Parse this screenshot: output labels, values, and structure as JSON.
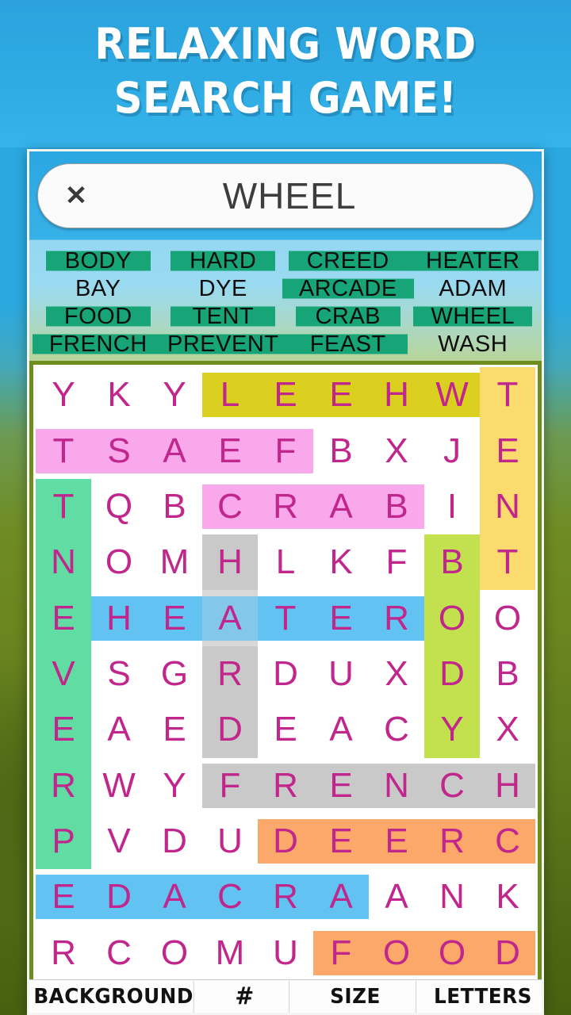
{
  "hero": {
    "line1": "RELAXING WORD",
    "line2": "SEARCH GAME!"
  },
  "search": {
    "value": "WHEEL",
    "clear_icon": "close-icon",
    "clear_glyph": "✕"
  },
  "wordlist": {
    "words": [
      {
        "text": "BODY",
        "found": true
      },
      {
        "text": "HARD",
        "found": true
      },
      {
        "text": "CREED",
        "found": true
      },
      {
        "text": "HEATER",
        "found": true
      },
      {
        "text": "BAY",
        "found": false
      },
      {
        "text": "DYE",
        "found": false
      },
      {
        "text": "ARCADE",
        "found": true
      },
      {
        "text": "ADAM",
        "found": false
      },
      {
        "text": "FOOD",
        "found": true
      },
      {
        "text": "TENT",
        "found": true
      },
      {
        "text": "CRAB",
        "found": true
      },
      {
        "text": "WHEEL",
        "found": true
      },
      {
        "text": "FRENCH",
        "found": true
      },
      {
        "text": "PREVENT",
        "found": true
      },
      {
        "text": "FEAST",
        "found": true
      },
      {
        "text": "WASH",
        "found": false
      }
    ],
    "found_bar_color": "#17a578",
    "panel_color": "#9adaf0"
  },
  "grid": {
    "rows": 11,
    "cols": 9,
    "letter_color": "#c0268c",
    "letters": [
      [
        "Y",
        "K",
        "Y",
        "L",
        "E",
        "E",
        "H",
        "W",
        "T"
      ],
      [
        "T",
        "S",
        "A",
        "E",
        "F",
        "B",
        "X",
        "J",
        "E"
      ],
      [
        "T",
        "Q",
        "B",
        "C",
        "R",
        "A",
        "B",
        "I",
        "N"
      ],
      [
        "N",
        "O",
        "M",
        "H",
        "L",
        "K",
        "F",
        "B",
        "T"
      ],
      [
        "E",
        "H",
        "E",
        "A",
        "T",
        "E",
        "R",
        "O",
        "O"
      ],
      [
        "V",
        "S",
        "G",
        "R",
        "D",
        "U",
        "X",
        "D",
        "B"
      ],
      [
        "E",
        "A",
        "E",
        "D",
        "E",
        "A",
        "C",
        "Y",
        "X"
      ],
      [
        "R",
        "W",
        "Y",
        "F",
        "R",
        "E",
        "N",
        "C",
        "H"
      ],
      [
        "P",
        "V",
        "D",
        "U",
        "D",
        "E",
        "E",
        "R",
        "C"
      ],
      [
        "E",
        "D",
        "A",
        "C",
        "R",
        "A",
        "A",
        "N",
        "K"
      ],
      [
        "R",
        "C",
        "O",
        "M",
        "U",
        "F",
        "O",
        "O",
        "D"
      ]
    ],
    "highlights": [
      {
        "word": "WHEEL",
        "color": "#dbd01f",
        "orientation": "h",
        "row": 0,
        "col": 3,
        "len": 5
      },
      {
        "word": "TENT",
        "color": "#fbda6e",
        "orientation": "v",
        "row": 0,
        "col": 8,
        "len": 4
      },
      {
        "word": "FEAST",
        "color": "#f9a8ec",
        "orientation": "h",
        "row": 1,
        "col": 0,
        "len": 5
      },
      {
        "word": "PREVENT",
        "color": "#61dca2",
        "orientation": "v",
        "row": 2,
        "col": 0,
        "len": 7
      },
      {
        "word": "CRAB",
        "color": "#f9a8ec",
        "orientation": "h",
        "row": 2,
        "col": 3,
        "len": 4
      },
      {
        "word": "HARD",
        "color": "#c9c9c9",
        "orientation": "v",
        "row": 3,
        "col": 3,
        "len": 4
      },
      {
        "word": "BODY",
        "color": "#c3e04f",
        "orientation": "v",
        "row": 3,
        "col": 7,
        "len": 4
      },
      {
        "word": "HEATER",
        "color": "#62c2f2",
        "orientation": "h",
        "row": 4,
        "col": 1,
        "len": 6
      },
      {
        "word": "FRENCH",
        "color": "#c9c9c9",
        "orientation": "h",
        "row": 7,
        "col": 3,
        "len": 6
      },
      {
        "word": "CREED",
        "color": "#fca86a",
        "orientation": "h",
        "row": 8,
        "col": 4,
        "len": 5
      },
      {
        "word": "ARCADE",
        "color": "#62c2f2",
        "orientation": "h",
        "row": 9,
        "col": 0,
        "len": 6
      },
      {
        "word": "FOOD",
        "color": "#fca86a",
        "orientation": "h",
        "row": 10,
        "col": 5,
        "len": 4
      }
    ]
  },
  "toolbar": {
    "items": [
      {
        "label": "BACKGROUND",
        "name": "background-button",
        "narrow": false
      },
      {
        "label": "#",
        "name": "hash-button",
        "narrow": true
      },
      {
        "label": "SIZE",
        "name": "size-button",
        "narrow": false
      },
      {
        "label": "LETTERS",
        "name": "letters-button",
        "narrow": false
      }
    ]
  }
}
